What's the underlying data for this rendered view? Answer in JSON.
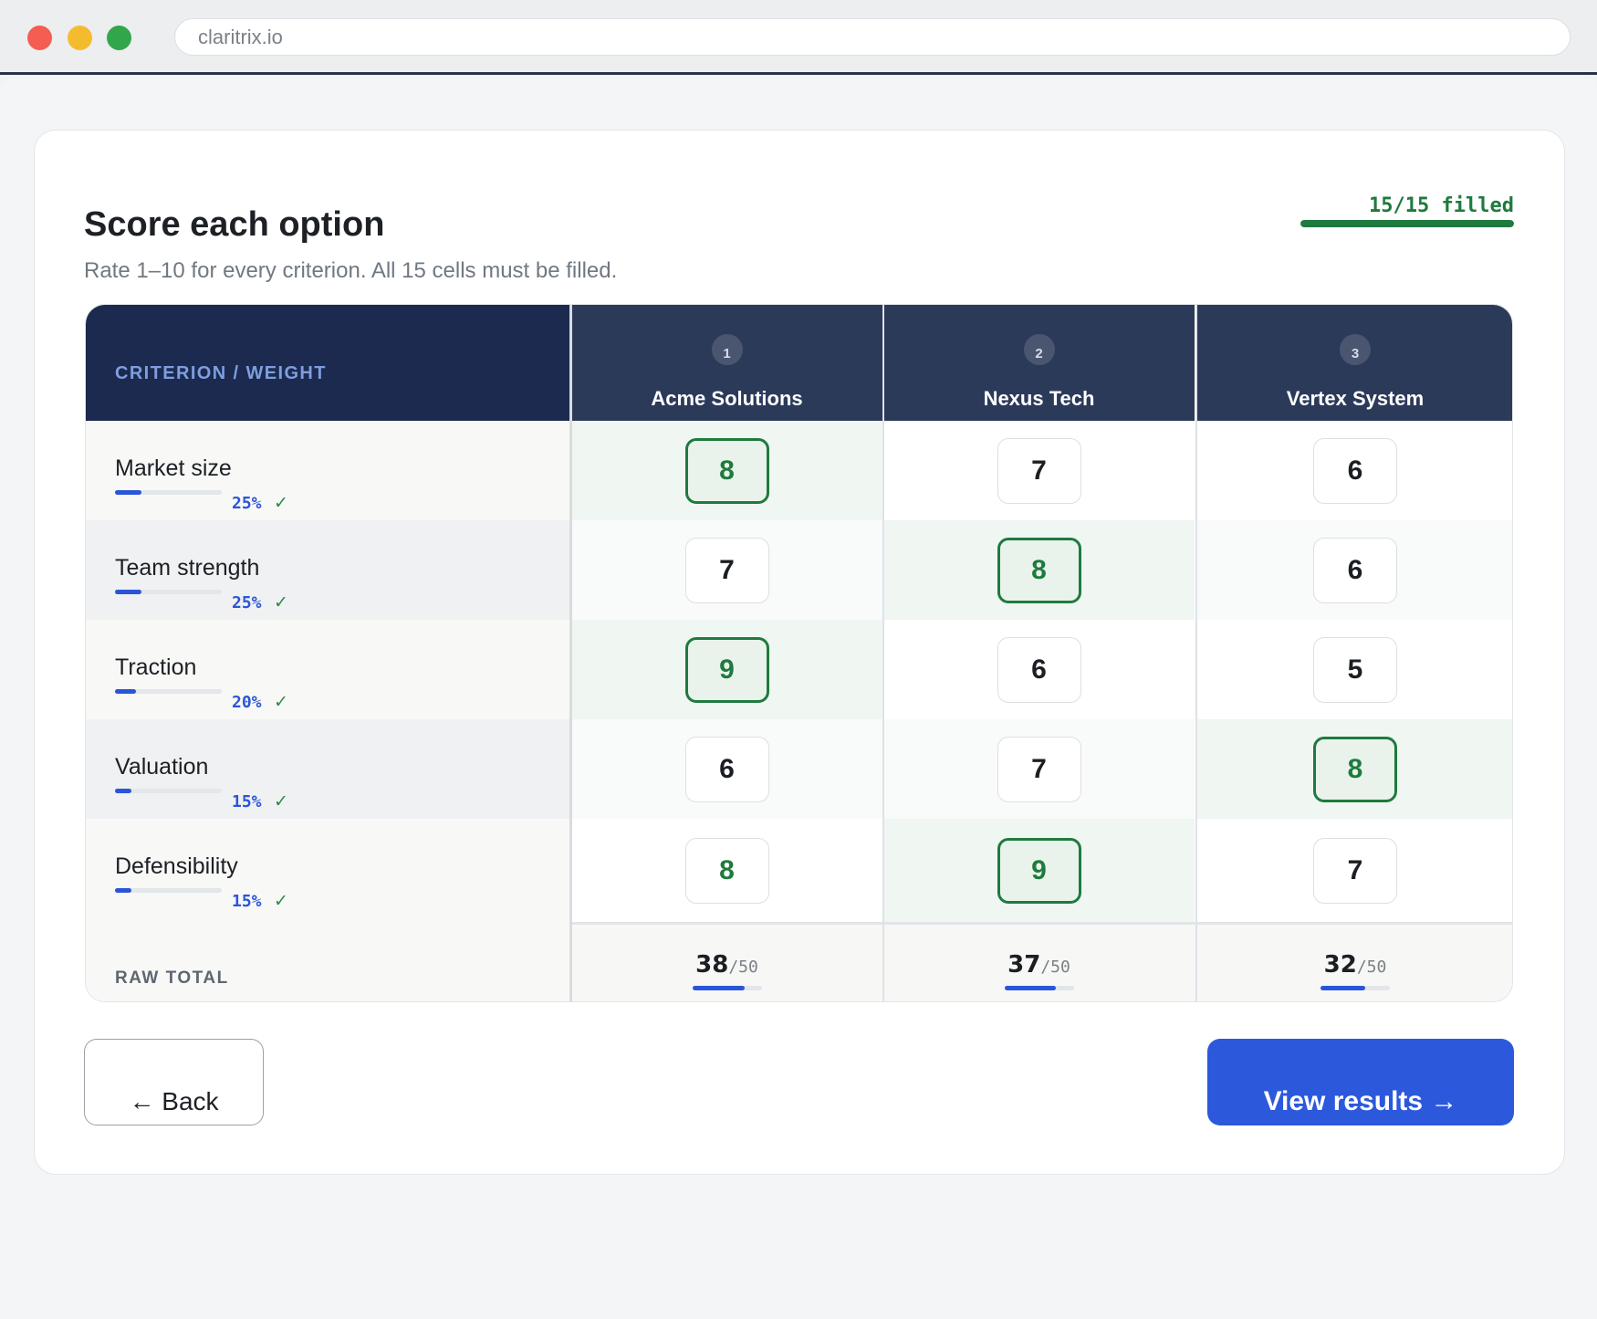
{
  "browser": {
    "url": "claritrix.io"
  },
  "page": {
    "title": "Score each option",
    "subtitle": "Rate 1–10 for every criterion. All 15 cells must be filled.",
    "progress": {
      "label": "15/15 filled",
      "filled": 15,
      "total": 15
    }
  },
  "table": {
    "header_label": "CRITERION / WEIGHT",
    "options": [
      {
        "number": "1",
        "name": "Acme Solutions"
      },
      {
        "number": "2",
        "name": "Nexus Tech"
      },
      {
        "number": "3",
        "name": "Vertex System"
      }
    ],
    "criteria": [
      {
        "name": "Market size",
        "weight": "25%",
        "weight_value": 25,
        "check": "✓",
        "scores": [
          "8",
          "7",
          "6"
        ]
      },
      {
        "name": "Team strength",
        "weight": "25%",
        "weight_value": 25,
        "check": "✓",
        "scores": [
          "7",
          "8",
          "6"
        ]
      },
      {
        "name": "Traction",
        "weight": "20%",
        "weight_value": 20,
        "check": "✓",
        "scores": [
          "9",
          "6",
          "5"
        ]
      },
      {
        "name": "Valuation",
        "weight": "15%",
        "weight_value": 15,
        "check": "✓",
        "scores": [
          "6",
          "7",
          "8"
        ]
      },
      {
        "name": "Defensibility",
        "weight": "15%",
        "weight_value": 15,
        "check": "✓",
        "scores": [
          "8",
          "9",
          "7"
        ]
      }
    ],
    "totals_label": "RAW TOTAL",
    "totals": [
      {
        "value": "38",
        "max": "/50"
      },
      {
        "value": "37",
        "max": "/50"
      },
      {
        "value": "32",
        "max": "/50"
      }
    ]
  },
  "actions": {
    "back_label": "← Back",
    "next_label": "View results →"
  },
  "colors": {
    "accent": "#2c58dc",
    "success": "#1f7a3e",
    "header_bg": "#1b2a4e"
  }
}
